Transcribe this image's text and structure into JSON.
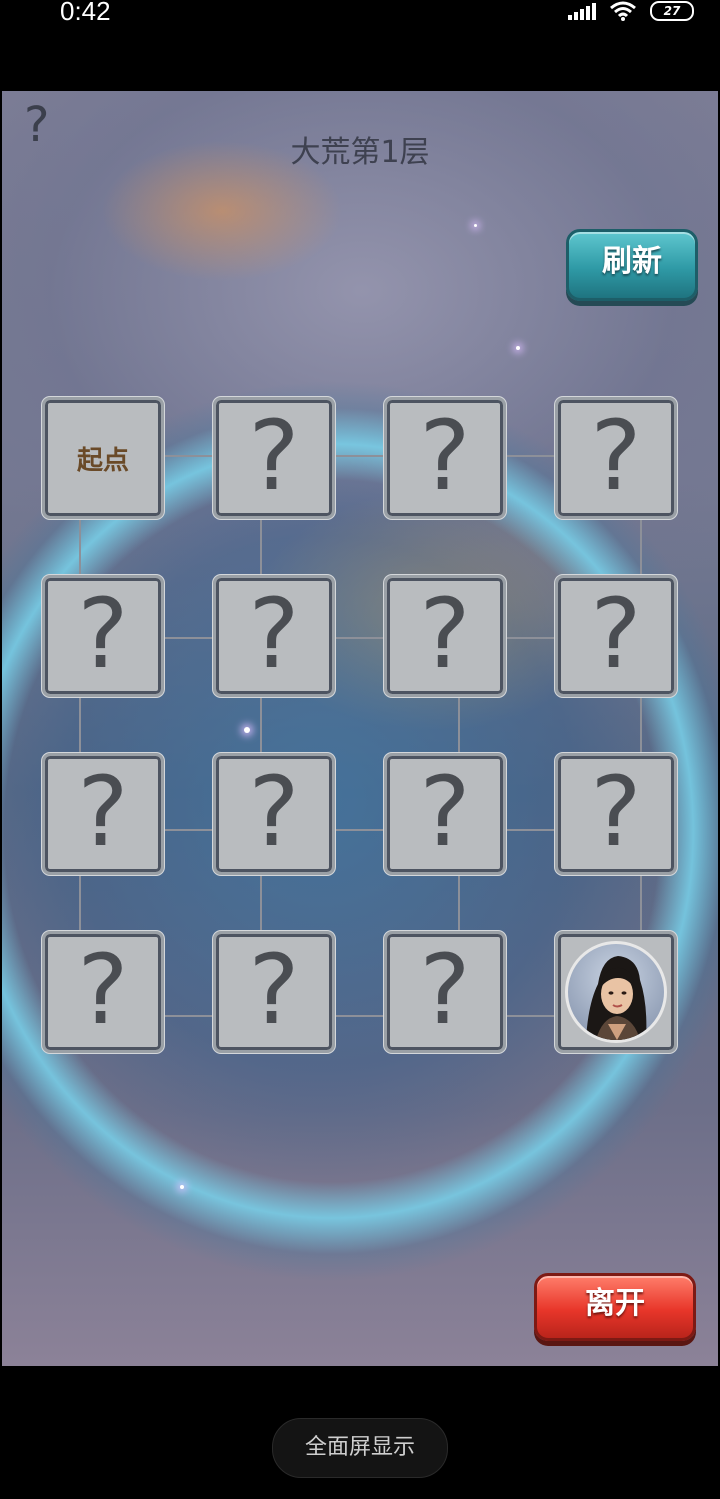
{
  "status": {
    "time": "0:42",
    "battery": "27"
  },
  "game": {
    "title": "大荒第1层",
    "help_icon": "?",
    "refresh_label": "刷新",
    "leave_label": "离开",
    "start_label": "起点",
    "unknown_symbol": "?",
    "grid": [
      [
        "start",
        "unknown",
        "unknown",
        "unknown"
      ],
      [
        "unknown",
        "unknown",
        "unknown",
        "unknown"
      ],
      [
        "unknown",
        "unknown",
        "unknown",
        "unknown"
      ],
      [
        "unknown",
        "unknown",
        "unknown",
        "player"
      ]
    ]
  },
  "nav": {
    "fullscreen_label": "全面屏显示"
  },
  "colors": {
    "refresh_button": "#2f9aa6",
    "leave_button": "#e8362a",
    "tile": "#b9bcbf"
  }
}
